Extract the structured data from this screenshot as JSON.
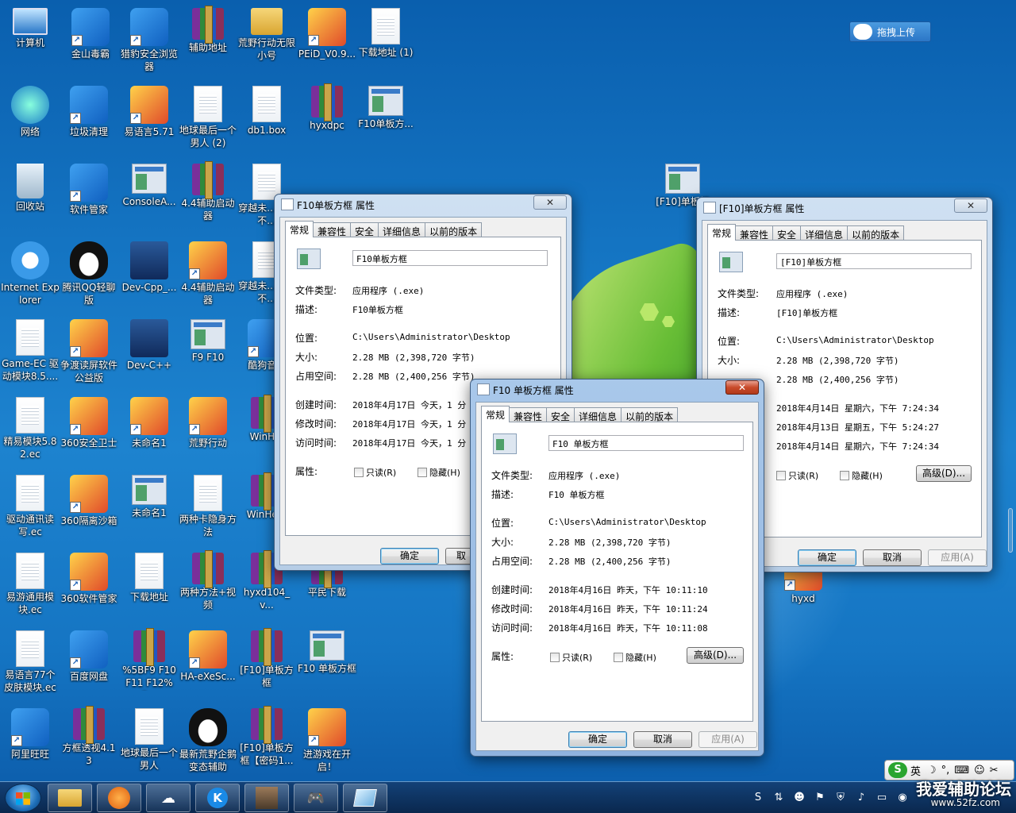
{
  "desktop_icons": [
    {
      "label": "计算机",
      "kind": "computer"
    },
    {
      "label": "金山毒霸",
      "kind": "shortcut"
    },
    {
      "label": "猎豹安全浏览器",
      "kind": "shortcut"
    },
    {
      "label": "辅助地址",
      "kind": "rar"
    },
    {
      "label": "荒野行动无限小号",
      "kind": "folder"
    },
    {
      "label": "PEiD_V0.9...",
      "kind": "app"
    },
    {
      "label": "下载地址 (1)",
      "kind": "doc"
    },
    {
      "label": "网络",
      "kind": "network"
    },
    {
      "label": "垃圾清理",
      "kind": "shortcut"
    },
    {
      "label": "易语言5.71",
      "kind": "app"
    },
    {
      "label": "地球最后一个男人 (2)",
      "kind": "doc"
    },
    {
      "label": "db1.box",
      "kind": "doc"
    },
    {
      "label": "hyxdpc",
      "kind": "rar"
    },
    {
      "label": "F10单板方...",
      "kind": "exe"
    },
    {
      "label": "回收站",
      "kind": "bin"
    },
    {
      "label": "软件管家",
      "kind": "shortcut"
    },
    {
      "label": "ConsoleA...",
      "kind": "exe"
    },
    {
      "label": "4.4辅助启动器",
      "kind": "rar"
    },
    {
      "label": "穿越未...男人不...",
      "kind": "doc"
    },
    {
      "label": "Internet Explorer",
      "kind": "ie"
    },
    {
      "label": "腾讯QQ轻聊版",
      "kind": "qq"
    },
    {
      "label": "Dev-Cpp_...",
      "kind": "dev"
    },
    {
      "label": "4.4辅助启动器",
      "kind": "app"
    },
    {
      "label": "穿越未...男人不...",
      "kind": "doc"
    },
    {
      "label": "Game-EC 驱动模块8.5....",
      "kind": "doc"
    },
    {
      "label": "争渡读屏软件公益版",
      "kind": "app"
    },
    {
      "label": "Dev-C++",
      "kind": "dev"
    },
    {
      "label": "F9 F10",
      "kind": "exe"
    },
    {
      "label": "酷狗音...",
      "kind": "shortcut"
    },
    {
      "label": "精易模块5.82.ec",
      "kind": "doc"
    },
    {
      "label": "360安全卫士",
      "kind": "app"
    },
    {
      "label": "未命名1",
      "kind": "app"
    },
    {
      "label": "荒野行动",
      "kind": "app"
    },
    {
      "label": "WinH...",
      "kind": "rar"
    },
    {
      "label": "驱动通讯读写.ec",
      "kind": "doc"
    },
    {
      "label": "360隔离沙箱",
      "kind": "app"
    },
    {
      "label": "未命名1",
      "kind": "exe"
    },
    {
      "label": "两种卡隐身方法",
      "kind": "doc"
    },
    {
      "label": "WinHe...",
      "kind": "rar"
    },
    {
      "label": "易游通用模块.ec",
      "kind": "doc"
    },
    {
      "label": "360软件管家",
      "kind": "app"
    },
    {
      "label": "下载地址",
      "kind": "doc"
    },
    {
      "label": "两种方法+视频",
      "kind": "rar"
    },
    {
      "label": "hyxd104_v...",
      "kind": "rar"
    },
    {
      "label": "平民下载",
      "kind": "rar"
    },
    {
      "label": "易语言77个皮肤模块.ec",
      "kind": "doc"
    },
    {
      "label": "百度网盘",
      "kind": "shortcut"
    },
    {
      "label": "%5BF9 F10 F11 F12%5...",
      "kind": "rar"
    },
    {
      "label": "HA-eXeSc...",
      "kind": "app"
    },
    {
      "label": "[F10]单板方框",
      "kind": "rar"
    },
    {
      "label": "F10 单板方框",
      "kind": "exe"
    },
    {
      "label": "阿里旺旺",
      "kind": "shortcut"
    },
    {
      "label": "方框透视4.13",
      "kind": "rar"
    },
    {
      "label": "地球最后一个男人",
      "kind": "doc"
    },
    {
      "label": "最新荒野企鹅变态辅助",
      "kind": "qq"
    },
    {
      "label": "[F10]单板方框【密码1...",
      "kind": "rar"
    },
    {
      "label": "进游戏在开启！",
      "kind": "app"
    },
    {
      "label": "[F10]单板框",
      "kind": "exe"
    },
    {
      "label": "hyxd",
      "kind": "app"
    }
  ],
  "upload_button": "拖拽上传",
  "win1": {
    "title": "F10单板方框 属性",
    "close": "✕",
    "tabs": [
      "常规",
      "兼容性",
      "安全",
      "详细信息",
      "以前的版本"
    ],
    "name": "F10单板方框",
    "type_label": "文件类型:",
    "type_value": "应用程序 (.exe)",
    "desc_label": "描述:",
    "desc_value": "F10单板方框",
    "loc_label": "位置:",
    "loc_value": "C:\\Users\\Administrator\\Desktop",
    "size_label": "大小:",
    "size_value": "2.28 MB (2,398,720 字节)",
    "disk_label": "占用空间:",
    "disk_value": "2.28 MB (2,400,256 字节)",
    "created_label": "创建时间:",
    "created_value": "2018年4月17日 今天，1 分",
    "modified_label": "修改时间:",
    "modified_value": "2018年4月17日 今天，1 分",
    "accessed_label": "访问时间:",
    "accessed_value": "2018年4月17日 今天，1 分",
    "attr_label": "属性:",
    "readonly": "只读(R)",
    "hidden": "隐藏(H)",
    "ok": "确定",
    "cancel": "取"
  },
  "win2": {
    "title": "[F10]单板方框 属性",
    "close": "✕",
    "tabs": [
      "常规",
      "兼容性",
      "安全",
      "详细信息",
      "以前的版本"
    ],
    "name": "[F10]单板方框",
    "type_label": "文件类型:",
    "type_value": "应用程序 (.exe)",
    "desc_label": "描述:",
    "desc_value": "[F10]单板方框",
    "loc_label": "位置:",
    "loc_value": "C:\\Users\\Administrator\\Desktop",
    "size_label": "大小:",
    "size_value": "2.28 MB (2,398,720 字节)",
    "disk_label": "占用空间:",
    "disk_value": "2.28 MB (2,400,256 字节)",
    "created_value": "2018年4月14日 星期六，下午 7:24:34",
    "modified_value": "2018年4月13日 星期五，下午 5:24:27",
    "accessed_value": "2018年4月14日 星期六，下午 7:24:34",
    "readonly": "只读(R)",
    "hidden": "隐藏(H)",
    "advanced": "高级(D)...",
    "ok": "确定",
    "cancel": "取消",
    "apply": "应用(A)"
  },
  "win3": {
    "title": "F10 单板方框 属性",
    "close": "✕",
    "tabs": [
      "常规",
      "兼容性",
      "安全",
      "详细信息",
      "以前的版本"
    ],
    "name": "F10 单板方框",
    "type_label": "文件类型:",
    "type_value": "应用程序 (.exe)",
    "desc_label": "描述:",
    "desc_value": "F10 单板方框",
    "loc_label": "位置:",
    "loc_value": "C:\\Users\\Administrator\\Desktop",
    "size_label": "大小:",
    "size_value": "2.28 MB (2,398,720 字节)",
    "disk_label": "占用空间:",
    "disk_value": "2.28 MB (2,400,256 字节)",
    "created_label": "创建时间:",
    "created_value": "2018年4月16日 昨天，下午 10:11:10",
    "modified_label": "修改时间:",
    "modified_value": "2018年4月16日 昨天，下午 10:11:24",
    "accessed_label": "访问时间:",
    "accessed_value": "2018年4月16日 昨天，下午 10:11:08",
    "attr_label": "属性:",
    "readonly": "只读(R)",
    "hidden": "隐藏(H)",
    "advanced": "高级(D)...",
    "ok": "确定",
    "cancel": "取消",
    "apply": "应用(A)"
  },
  "ime": {
    "mode": "英"
  },
  "watermark": "我爱辅助论坛",
  "watermark_url": "www.52fz.com"
}
